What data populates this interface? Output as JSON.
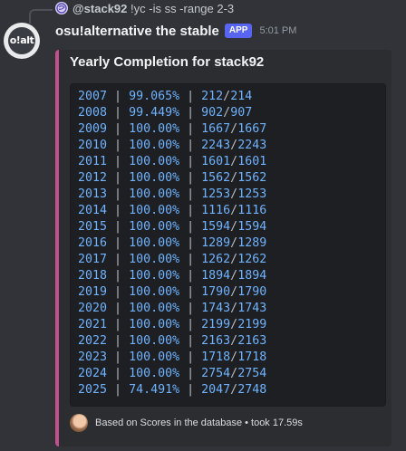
{
  "reply": {
    "user": "@stack92",
    "command": "!yc -is ss -range 2-3"
  },
  "message": {
    "author": "osu!alternative the stable",
    "badge": "APP",
    "time": "5:01 PM",
    "avatar_text": "o!alt"
  },
  "embed": {
    "accent_color": "#c2508f",
    "title": "Yearly Completion for stack92",
    "rows": [
      {
        "year": "2007",
        "pct": "99.065%",
        "done": "212",
        "total": "214"
      },
      {
        "year": "2008",
        "pct": "99.449%",
        "done": "902",
        "total": "907"
      },
      {
        "year": "2009",
        "pct": "100.00%",
        "done": "1667",
        "total": "1667"
      },
      {
        "year": "2010",
        "pct": "100.00%",
        "done": "2243",
        "total": "2243"
      },
      {
        "year": "2011",
        "pct": "100.00%",
        "done": "1601",
        "total": "1601"
      },
      {
        "year": "2012",
        "pct": "100.00%",
        "done": "1562",
        "total": "1562"
      },
      {
        "year": "2013",
        "pct": "100.00%",
        "done": "1253",
        "total": "1253"
      },
      {
        "year": "2014",
        "pct": "100.00%",
        "done": "1116",
        "total": "1116"
      },
      {
        "year": "2015",
        "pct": "100.00%",
        "done": "1594",
        "total": "1594"
      },
      {
        "year": "2016",
        "pct": "100.00%",
        "done": "1289",
        "total": "1289"
      },
      {
        "year": "2017",
        "pct": "100.00%",
        "done": "1262",
        "total": "1262"
      },
      {
        "year": "2018",
        "pct": "100.00%",
        "done": "1894",
        "total": "1894"
      },
      {
        "year": "2019",
        "pct": "100.00%",
        "done": "1790",
        "total": "1790"
      },
      {
        "year": "2020",
        "pct": "100.00%",
        "done": "1743",
        "total": "1743"
      },
      {
        "year": "2021",
        "pct": "100.00%",
        "done": "2199",
        "total": "2199"
      },
      {
        "year": "2022",
        "pct": "100.00%",
        "done": "2163",
        "total": "2163"
      },
      {
        "year": "2023",
        "pct": "100.00%",
        "done": "1718",
        "total": "1718"
      },
      {
        "year": "2024",
        "pct": "100.00%",
        "done": "2754",
        "total": "2754"
      },
      {
        "year": "2025",
        "pct": "74.491%",
        "done": "2047",
        "total": "2748"
      }
    ],
    "footer": "Based on Scores in the database • took 17.59s"
  }
}
